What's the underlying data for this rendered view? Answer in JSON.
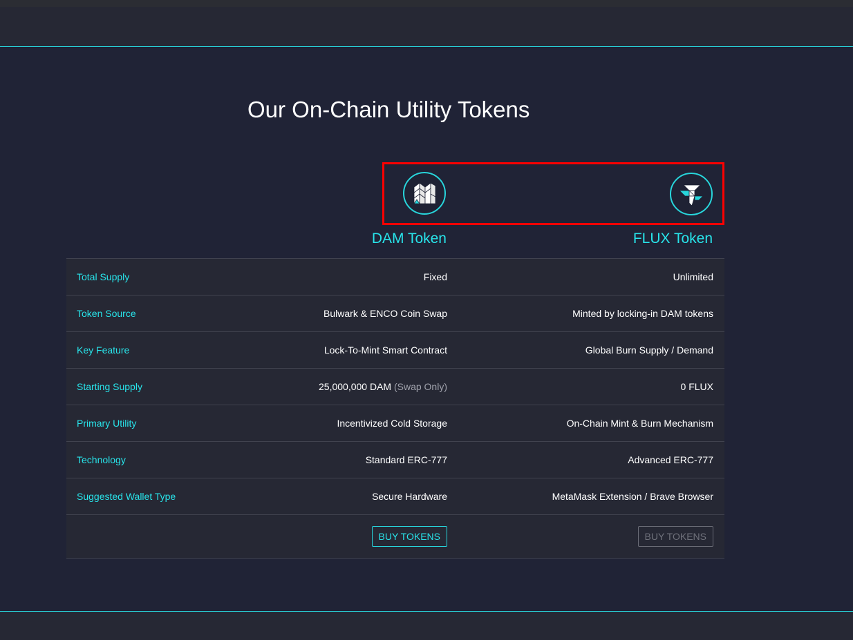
{
  "page": {
    "title": "Our On-Chain Utility Tokens"
  },
  "tokens": {
    "dam": {
      "name": "DAM Token",
      "icon": "dam-logo-icon",
      "buy_label": "BUY TOKENS",
      "buy_enabled": true
    },
    "flux": {
      "name": "FLUX Token",
      "icon": "flux-logo-icon",
      "buy_label": "BUY TOKENS",
      "buy_enabled": false
    }
  },
  "rows": [
    {
      "label": "Total Supply",
      "dam": "Fixed",
      "flux": "Unlimited"
    },
    {
      "label": "Token Source",
      "dam": "Bulwark & ENCO Coin Swap",
      "flux": "Minted by locking-in DAM tokens"
    },
    {
      "label": "Key Feature",
      "dam": "Lock-To-Mint Smart Contract",
      "flux": "Global Burn Supply / Demand"
    },
    {
      "label": "Starting Supply",
      "dam": "25,000,000 DAM",
      "dam_note": "(Swap Only)",
      "flux": "0 FLUX"
    },
    {
      "label": "Primary Utility",
      "dam": "Incentivized Cold Storage",
      "flux": "On-Chain Mint & Burn Mechanism"
    },
    {
      "label": "Technology",
      "dam": "Standard ERC-777",
      "flux": "Advanced ERC-777"
    },
    {
      "label": "Suggested Wallet Type",
      "dam": "Secure Hardware",
      "flux": "MetaMask Extension / Brave Browser"
    }
  ],
  "colors": {
    "background": "#202336",
    "panel": "#262834",
    "accent": "#28e4ea",
    "highlight_box": "#ff0000"
  }
}
